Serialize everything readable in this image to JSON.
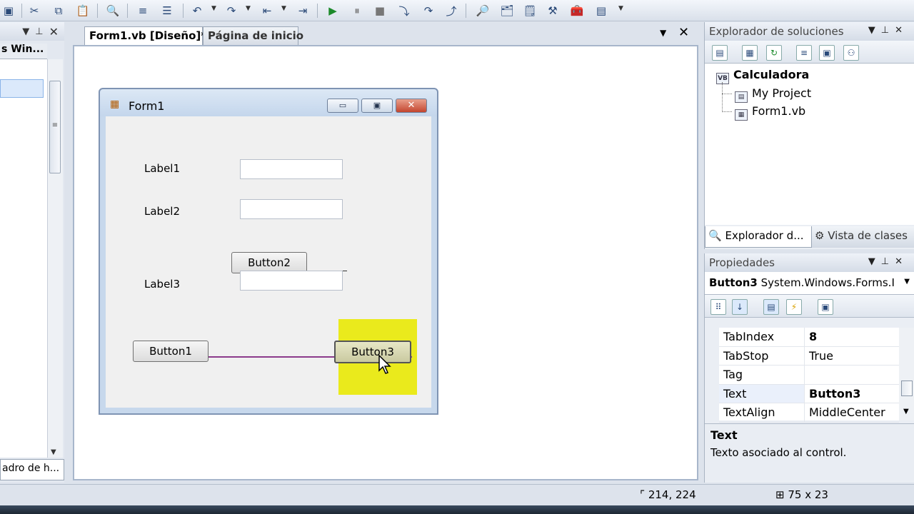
{
  "toolbox": {
    "category_label": "s Win...",
    "bottom_tab_label": "adro de h..."
  },
  "documents": {
    "tabs": [
      {
        "label": "Form1.vb [Diseño]*"
      },
      {
        "label": "Página de inicio"
      }
    ]
  },
  "form": {
    "title": "Form1",
    "labels": [
      "Label1",
      "Label2",
      "Label3"
    ],
    "buttons": {
      "button1": "Button1",
      "button2": "Button2",
      "button3": "Button3"
    }
  },
  "solution_explorer": {
    "title": "Explorador de soluciones",
    "tree": {
      "root": "Calculadora",
      "children": [
        "My Project",
        "Form1.vb"
      ]
    },
    "tabs": [
      "Explorador d...",
      "Vista de clases"
    ]
  },
  "properties": {
    "title": "Propiedades",
    "object_name": "Button3",
    "object_type": "System.Windows.Forms.I",
    "rows": [
      {
        "name": "TabIndex",
        "value": "8"
      },
      {
        "name": "TabStop",
        "value": "True"
      },
      {
        "name": "Tag",
        "value": ""
      },
      {
        "name": "Text",
        "value": "Button3"
      },
      {
        "name": "TextAlign",
        "value": "MiddleCenter"
      }
    ],
    "description_title": "Text",
    "description_text": "Texto asociado al control."
  },
  "status": {
    "position": "214, 224",
    "size": "75 x 23"
  },
  "colors": {
    "highlight": "#eaea1c",
    "snapline": "#8b3a8b"
  }
}
